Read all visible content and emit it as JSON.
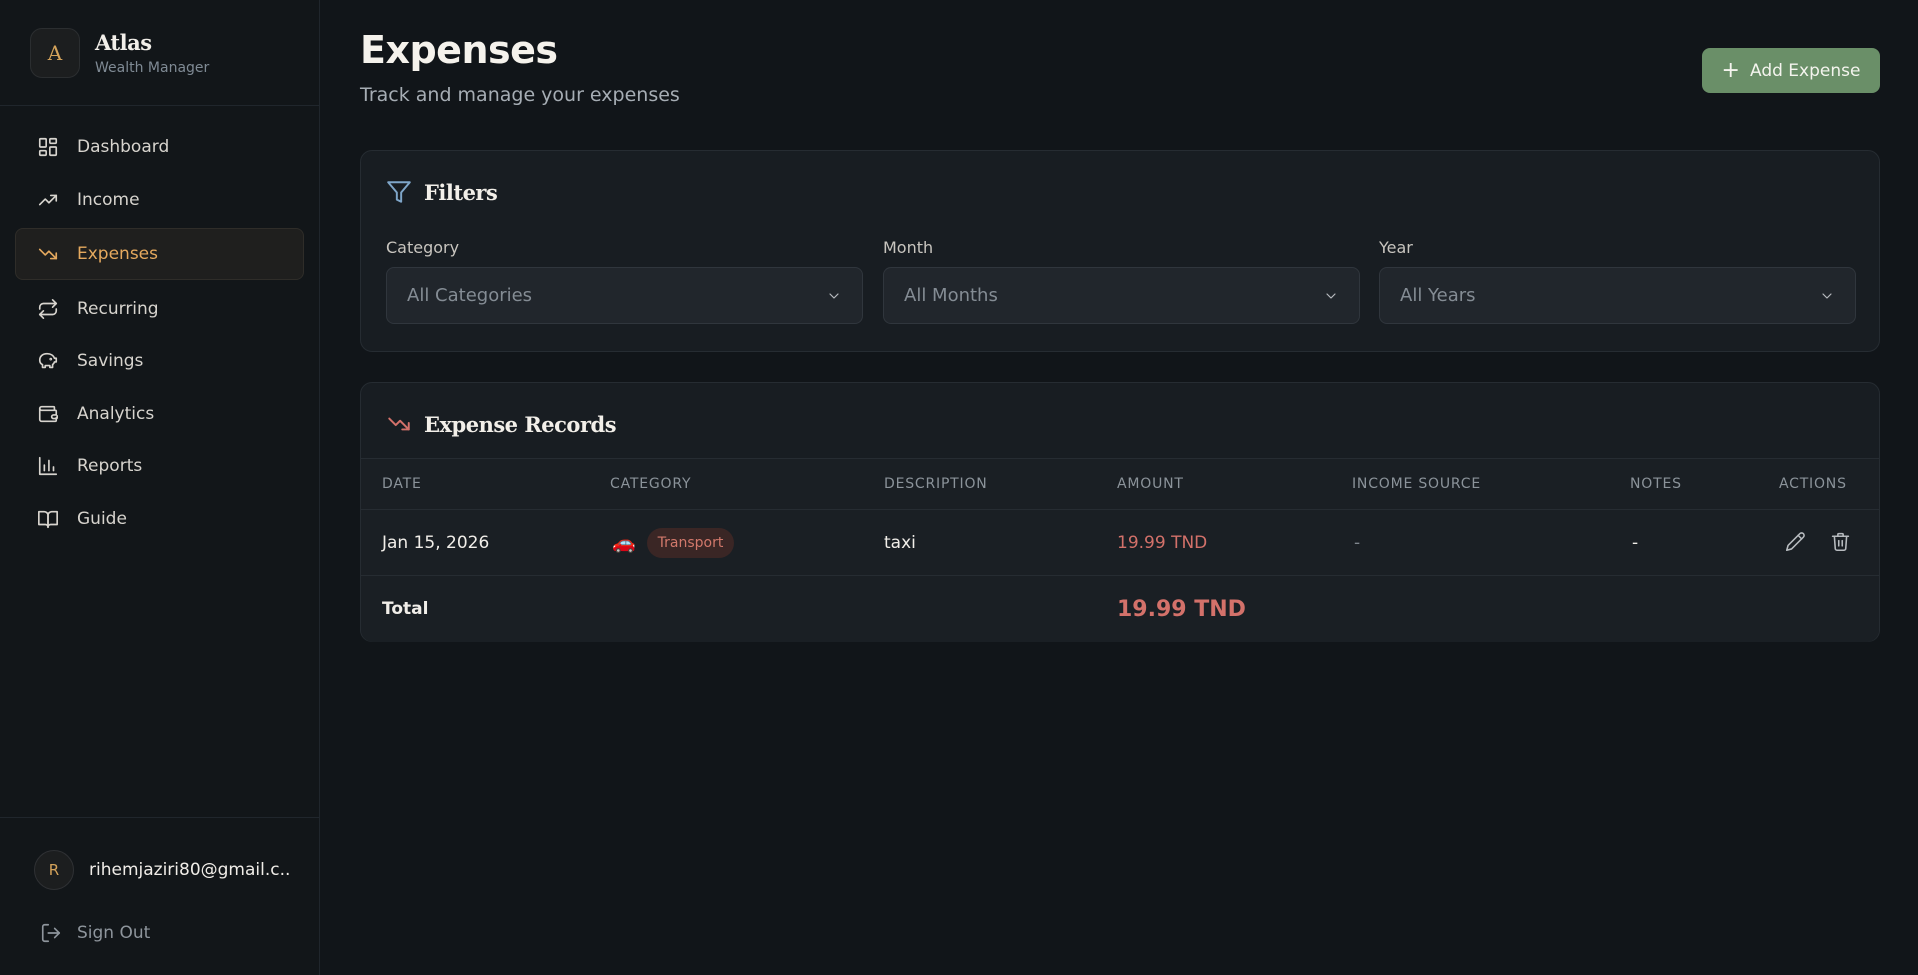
{
  "brand": {
    "logo_letter": "A",
    "name": "Atlas",
    "subtitle": "Wealth Manager"
  },
  "nav": [
    {
      "label": "Dashboard",
      "icon": "dashboard-grid-icon"
    },
    {
      "label": "Income",
      "icon": "trending-up-icon"
    },
    {
      "label": "Expenses",
      "icon": "trending-down-icon",
      "active": true
    },
    {
      "label": "Recurring",
      "icon": "repeat-icon"
    },
    {
      "label": "Savings",
      "icon": "piggy-bank-icon"
    },
    {
      "label": "Analytics",
      "icon": "wallet-icon"
    },
    {
      "label": "Reports",
      "icon": "bar-chart-icon"
    },
    {
      "label": "Guide",
      "icon": "book-icon"
    }
  ],
  "user": {
    "avatar_letter": "R",
    "email": "rihemjaziri80@gmail.c..."
  },
  "signout_label": "Sign Out",
  "page": {
    "title": "Expenses",
    "subtitle": "Track and manage your expenses",
    "add_button": "Add Expense"
  },
  "filters": {
    "title": "Filters",
    "category": {
      "label": "Category",
      "value": "All Categories"
    },
    "month": {
      "label": "Month",
      "value": "All Months"
    },
    "year": {
      "label": "Year",
      "value": "All Years"
    }
  },
  "records": {
    "title": "Expense Records",
    "columns": [
      "DATE",
      "CATEGORY",
      "DESCRIPTION",
      "AMOUNT",
      "INCOME SOURCE",
      "NOTES",
      "ACTIONS"
    ],
    "rows": [
      {
        "date": "Jan 15, 2026",
        "category_emoji": "🚗",
        "category": "Transport",
        "description": "taxi",
        "amount": "19.99 TND",
        "income_source": "-",
        "notes": "-"
      }
    ],
    "total_label": "Total",
    "total_amount": "19.99 TND"
  },
  "colors": {
    "accent_gold": "#e5a95e",
    "primary_green": "#6a8f68",
    "expense_red": "#d3716a",
    "filter_blue": "#7fa6c9"
  }
}
